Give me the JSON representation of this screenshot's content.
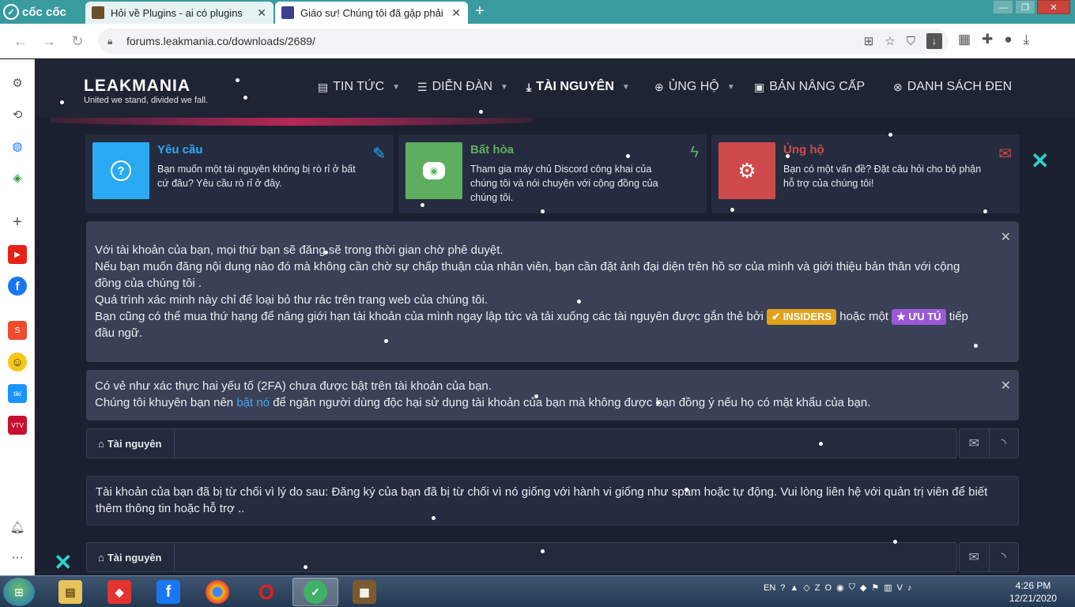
{
  "browser": {
    "logo_text": "cốc cốc",
    "tabs": [
      {
        "title": "Hỏi về Plugins - ai có plugins"
      },
      {
        "title": "Giáo sư! Chúng tôi đã gặp phải"
      }
    ],
    "close_glyph": "✕",
    "new_tab_glyph": "+",
    "url": "forums.leakmania.co/downloads/2689/",
    "window_controls": [
      "—",
      "❐",
      "✕"
    ]
  },
  "site": {
    "logo": "LEAKMANIA",
    "tagline": "United we stand, divided we fall.",
    "nav": [
      {
        "label": "TIN TỨC",
        "icon": "newspaper-icon",
        "glyph": "▤",
        "caret": "▼"
      },
      {
        "label": "DIỄN ĐÀN",
        "icon": "list-icon",
        "glyph": "☰",
        "caret": "▼"
      },
      {
        "label": "TÀI NGUYÊN",
        "icon": "download-icon",
        "glyph": "⤓",
        "caret": "▼"
      },
      {
        "label": "ỦNG HỘ",
        "icon": "lifering-icon",
        "glyph": "⊕",
        "caret": "▼"
      },
      {
        "label": "BẢN NÂNG CẤP",
        "icon": "money-icon",
        "glyph": "▣",
        "caret": ""
      },
      {
        "label": "DANH SÁCH ĐEN",
        "icon": "ban-icon",
        "glyph": "⊗",
        "caret": ""
      }
    ]
  },
  "cards": [
    {
      "title": "Yêu cầu",
      "text": "Bạn muốn một tài nguyên không bị rò rỉ ở bất cứ đâu? Yêu cầu rò rỉ ở đây.",
      "color": "#29aaf3",
      "square_glyph": "?",
      "corner_glyph": "✎"
    },
    {
      "title": "Bất hòa",
      "text": "Tham gia máy chủ Discord công khai của chúng tôi và nói chuyện với cộng đồng của chúng tôi.",
      "color": "#5fae5f",
      "square_glyph": "◉",
      "corner_glyph": "ϟ"
    },
    {
      "title": "Ủng hộ",
      "text": "Bạn có một vấn đề? Đặt câu hỏi cho bộ phận hỗ trợ của chúng tôi!",
      "color": "#cf4a4a",
      "square_glyph": "⚙",
      "corner_glyph": "✉"
    }
  ],
  "notice1": {
    "line1": "Với tài khoản của bạn, mọi thứ bạn sẽ đăng sẽ trong thời gian chờ phê duyệt.",
    "line2": "Nếu bạn muốn đăng nội dung nào đó mà không cần chờ sự chấp thuận của nhân viên, bạn cần đặt ảnh đại diện trên hồ sơ của mình và giới thiệu bản thân với cộng đồng của chúng tôi .",
    "line3": "Quá trình xác minh này chỉ để loại bỏ thư rác trên trang web của chúng tôi.",
    "line4_a": "Bạn cũng có thể mua thứ hạng để nâng giới hạn tài khoản của mình ngay lập tức và tải xuống các tài nguyên được gắn thẻ bởi",
    "badge_insiders": "✔ INSIDERS",
    "line4_b": "hoặc một",
    "badge_uutu": "★ ƯU TÚ",
    "line4_c": "tiếp đầu ngữ.",
    "close": "✕"
  },
  "notice2": {
    "line1": "Có vẻ như xác thực hai yếu tố (2FA) chưa được bật trên tài khoản của bạn.",
    "line2_a": "Chúng tôi khuyên bạn nên",
    "link": "bật nó",
    "line2_b": "để ngăn người dùng độc hại sử dụng tài khoản của bạn mà không được bạn đồng ý nếu họ có mặt khẩu của bạn.",
    "close": "✕"
  },
  "breadcrumb": {
    "home_glyph": "⌂",
    "label": "Tài nguyên",
    "mail_glyph": "✉",
    "rss_glyph": "◝"
  },
  "rejection": {
    "text": "Tài khoản của bạn đã bị từ chối vì lý do sau: Đăng ký của bạn đã bị từ chối vì nó giống với hành vi giống như spam hoặc tự động. Vui lòng liên hệ với quản trị viên để biết thêm thông tin hoặc hỗ trợ .."
  },
  "taskbar": {
    "lang": "EN",
    "time": "4:26 PM",
    "date": "12/21/2020"
  }
}
